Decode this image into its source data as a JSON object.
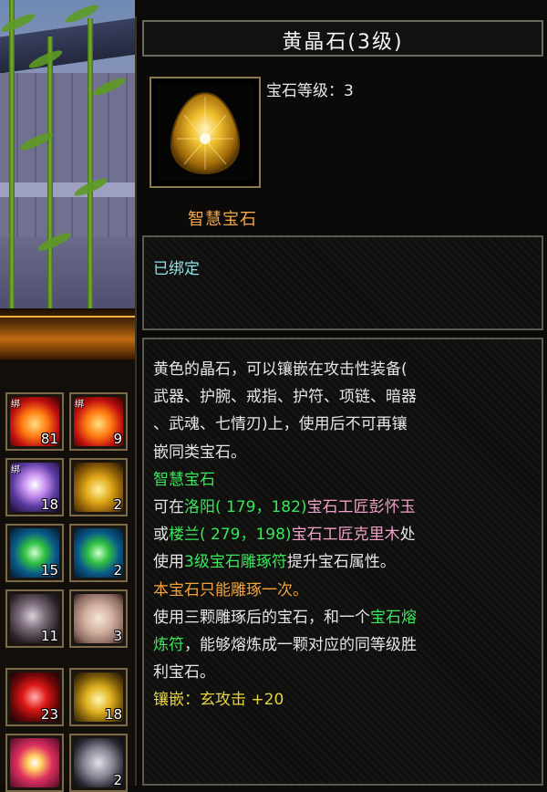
{
  "tooltip": {
    "title": "黄晶石(3级)",
    "gem_level_label": "宝石等级：",
    "gem_level_value": "3",
    "gem_category": "智慧宝石",
    "bound_status": "已绑定",
    "description": {
      "line1": "黄色的晶石，可以镶嵌在攻击性装备(",
      "line2": "武器、护腕、戒指、护符、项链、暗器",
      "line3": "、武魂、七情刃)上，使用后不可再镶",
      "line4": "嵌同类宝石。",
      "gem_type": "智慧宝石",
      "loc1_prefix": "可在",
      "loc1_city": "洛阳",
      "loc1_coords": "( 179，182)",
      "loc1_npc": "宝石工匠彭怀玉",
      "loc2_prefix": "或",
      "loc2_city": "楼兰",
      "loc2_coords": "( 279，198)",
      "loc2_npc": "宝石工匠克里木",
      "loc2_suffix": "处",
      "use_prefix": "使用",
      "use_item": "3级宝石雕琢符",
      "use_suffix": "提升宝石属性。",
      "warning": "本宝石只能雕琢一次。",
      "fuse_a": "使用三颗雕琢后的宝石，和一个",
      "fuse_item_a": "宝石熔",
      "fuse_item_b": "炼符",
      "fuse_b": "，能够熔炼成一颗对应的同等级胜",
      "fuse_c": "利宝石。",
      "inlay_label": "镶嵌：",
      "inlay_stat": "玄攻击",
      "inlay_value": "+20"
    }
  },
  "inventory": {
    "slots": [
      {
        "icon": "fire-crystal-icon",
        "count": "81",
        "bound": "绑"
      },
      {
        "icon": "fire-crystal-icon",
        "count": "9",
        "bound": "绑"
      },
      {
        "icon": "crown-icon",
        "count": "18",
        "bound": "绑"
      },
      {
        "icon": "gold-pouch-icon",
        "count": "2",
        "bound": ""
      },
      {
        "icon": "green-gem-icon",
        "count": "15",
        "bound": ""
      },
      {
        "icon": "green-gem-icon",
        "count": "2",
        "bound": ""
      },
      {
        "icon": "ore-icon",
        "count": "11",
        "bound": ""
      },
      {
        "icon": "cloth-icon",
        "count": "3",
        "bound": ""
      },
      {
        "icon": "red-gem-icon",
        "count": "23",
        "bound": ""
      },
      {
        "icon": "yellow-gem-icon",
        "count": "18",
        "bound": ""
      },
      {
        "icon": "sun-orb-icon",
        "count": "",
        "bound": ""
      },
      {
        "icon": "hex-gem-icon",
        "count": "2",
        "bound": ""
      }
    ]
  },
  "colors": {
    "title_text": "#f4f4f4",
    "gem_category": "#f2a84a",
    "bound_text": "#8fe4ec",
    "highlight_green": "#38e85a",
    "npc_pink": "#f0a0c8",
    "warning_orange": "#f2a43a",
    "stat_yellow": "#e8d440"
  }
}
